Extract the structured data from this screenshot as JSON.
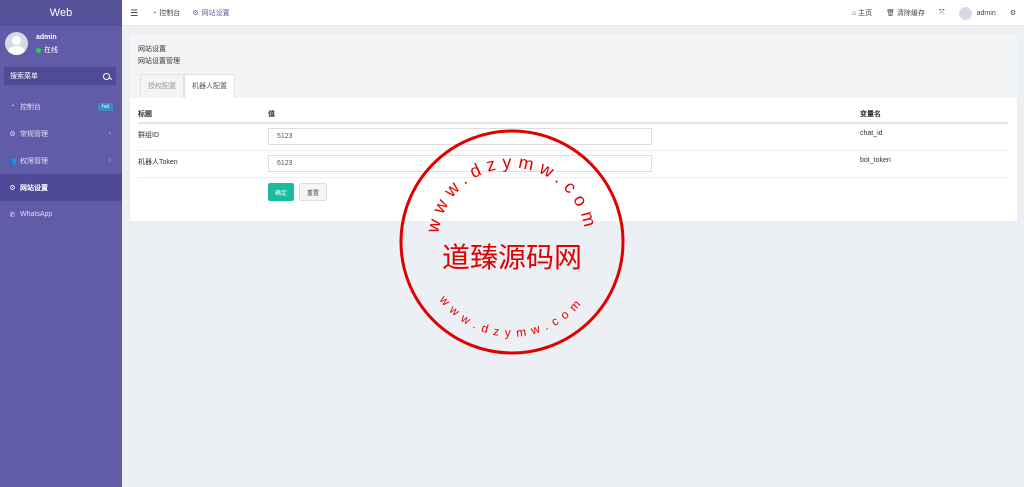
{
  "sidebar": {
    "logo": "Web",
    "user": {
      "name": "admin",
      "status": "在线"
    },
    "search_placeholder": "搜索菜单",
    "items": [
      {
        "label": "控制台",
        "icon": "dashboard-icon",
        "badge": "hot"
      },
      {
        "label": "常规管理",
        "icon": "gears-icon",
        "chevron": "‹"
      },
      {
        "label": "权限管理",
        "icon": "users-icon",
        "chevron": "‹"
      },
      {
        "label": "网站设置",
        "icon": "gears-icon",
        "active": true
      },
      {
        "label": "WhatsApp",
        "icon": "whatsapp-icon"
      }
    ]
  },
  "header": {
    "tabs": [
      {
        "label": "控制台",
        "icon": "dashboard-icon"
      },
      {
        "label": "网站设置",
        "icon": "gears-icon",
        "active": true
      }
    ],
    "right": {
      "home": "主页",
      "clear_cache": "清除缓存",
      "user": "admin"
    }
  },
  "content": {
    "title": "网站设置",
    "subtitle": "网站设置管理",
    "tabs": [
      {
        "label": "授权配置",
        "active": false
      },
      {
        "label": "机器人配置",
        "active": true
      }
    ],
    "table": {
      "headers": [
        "标题",
        "值",
        "变量名"
      ],
      "rows": [
        {
          "title": "群组ID",
          "value": "5123",
          "var": "chat_id"
        },
        {
          "title": "机器人Token",
          "value": "6123",
          "var": "bot_token"
        }
      ]
    },
    "buttons": {
      "ok": "确定",
      "reset": "重置"
    }
  },
  "watermark": {
    "center_text": "道臻源码网",
    "top_text": "www.dzymw.com",
    "bottom_text": "www.dzymw.com",
    "color": "#e00000"
  }
}
